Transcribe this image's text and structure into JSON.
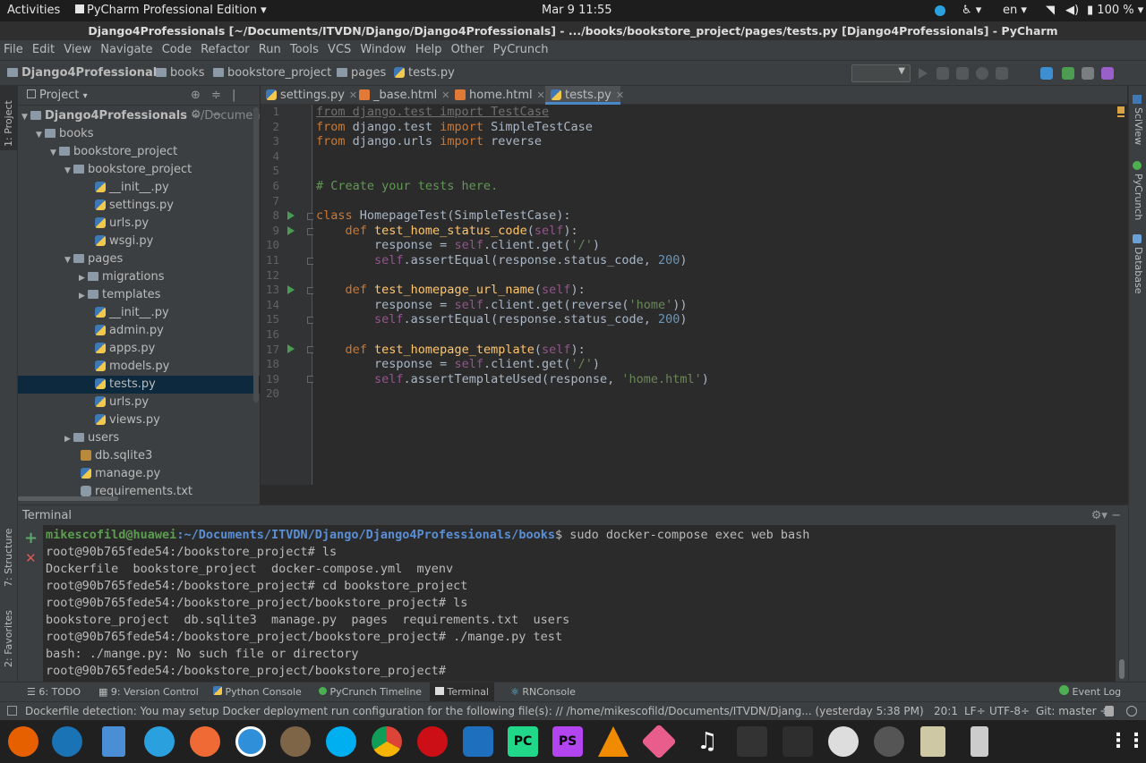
{
  "topbar": {
    "activities": "Activities",
    "app_menu": "PyCharm Professional Edition",
    "datetime": "Mar 9  11:55",
    "lang": "en",
    "battery": "100 %"
  },
  "window": {
    "title": "Django4Professionals [~/Documents/ITVDN/Django/Django4Professionals] - .../books/bookstore_project/pages/tests.py [Django4Professionals] - PyCharm"
  },
  "menu": [
    "File",
    "Edit",
    "View",
    "Navigate",
    "Code",
    "Refactor",
    "Run",
    "Tools",
    "VCS",
    "Window",
    "Help",
    "Other",
    "PyCrunch"
  ],
  "breadcrumbs": [
    "Django4Professionals",
    "books",
    "bookstore_project",
    "pages",
    "tests.py"
  ],
  "project": {
    "header": "Project",
    "tree": [
      {
        "label": "Django4Professionals",
        "extra": "~/Documents/IT"
      },
      {
        "label": "books"
      },
      {
        "label": "bookstore_project"
      },
      {
        "label": "bookstore_project"
      },
      {
        "label": "__init__.py"
      },
      {
        "label": "settings.py"
      },
      {
        "label": "urls.py"
      },
      {
        "label": "wsgi.py"
      },
      {
        "label": "pages"
      },
      {
        "label": "migrations"
      },
      {
        "label": "templates"
      },
      {
        "label": "__init__.py"
      },
      {
        "label": "admin.py"
      },
      {
        "label": "apps.py"
      },
      {
        "label": "models.py"
      },
      {
        "label": "tests.py"
      },
      {
        "label": "urls.py"
      },
      {
        "label": "views.py"
      },
      {
        "label": "users"
      },
      {
        "label": "db.sqlite3"
      },
      {
        "label": "manage.py"
      },
      {
        "label": "requirements.txt"
      }
    ]
  },
  "tabs": [
    "settings.py",
    "_base.html",
    "home.html",
    "tests.py"
  ],
  "editor": {
    "line_numbers": [
      "1",
      "2",
      "3",
      "4",
      "5",
      "6",
      "7",
      "8",
      "9",
      "10",
      "11",
      "12",
      "13",
      "14",
      "15",
      "16",
      "17",
      "18",
      "19",
      "20"
    ],
    "lines": {
      "l1": "from django.test import TestCase",
      "l2a": "from",
      "l2b": " django.test ",
      "l2c": "import",
      "l2d": " SimpleTestCase",
      "l3a": "from",
      "l3b": " django.urls ",
      "l3c": "import",
      "l3d": " reverse",
      "l6": "# Create your tests here.",
      "l8a": "class",
      "l8b": " HomepageTest",
      "l8c": "(SimpleTestCase):",
      "l9a": "    def",
      "l9b": " test_home_status_code",
      "l9c": "(",
      "l9d": "self",
      "l9e": "):",
      "l10a": "        response = ",
      "l10b": "self",
      "l10c": ".client.get(",
      "l10d": "'/'",
      "l10e": ")",
      "l11a": "        ",
      "l11b": "self",
      "l11c": ".assertEqual(response.status_code, ",
      "l11d": "200",
      "l11e": ")",
      "l13a": "    def",
      "l13b": " test_homepage_url_name",
      "l13c": "(",
      "l13d": "self",
      "l13e": "):",
      "l14a": "        response = ",
      "l14b": "self",
      "l14c": ".client.get(reverse(",
      "l14d": "'home'",
      "l14e": "))",
      "l15a": "        ",
      "l15b": "self",
      "l15c": ".assertEqual(response.status_code, ",
      "l15d": "200",
      "l15e": ")",
      "l17a": "    def",
      "l17b": " test_homepage_template",
      "l17c": "(",
      "l17d": "self",
      "l17e": "):",
      "l18a": "        response = ",
      "l18b": "self",
      "l18c": ".client.get(",
      "l18d": "'/'",
      "l18e": ")",
      "l19a": "        ",
      "l19b": "self",
      "l19c": ".assertTemplateUsed(response, ",
      "l19d": "'home.html'",
      "l19e": ")"
    }
  },
  "right_tools": [
    "SciView",
    "PyCrunch",
    "Database"
  ],
  "left_tools": [
    "1: Project",
    "7: Structure",
    "2: Favorites"
  ],
  "terminal": {
    "title": "Terminal",
    "user": "mikescofild@huawei",
    "path": ":~/Documents/ITVDN/Django/Django4Professionals/books",
    "cmd": "$ sudo docker-compose exec web bash",
    "lines": [
      "root@90b765fede54:/bookstore_project# ls",
      "Dockerfile  bookstore_project  docker-compose.yml  myenv",
      "root@90b765fede54:/bookstore_project# cd bookstore_project",
      "root@90b765fede54:/bookstore_project/bookstore_project# ls",
      "bookstore_project  db.sqlite3  manage.py  pages  requirements.txt  users",
      "root@90b765fede54:/bookstore_project/bookstore_project# ./mange.py test",
      "bash: ./mange.py: No such file or directory",
      "root@90b765fede54:/bookstore_project/bookstore_project#"
    ]
  },
  "toolwindows": [
    "6: TODO",
    "9: Version Control",
    "Python Console",
    "PyCrunch Timeline",
    "Terminal",
    "RNConsole",
    "Event Log"
  ],
  "status": {
    "message": "Dockerfile detection: You may setup Docker deployment run configuration for the following file(s): // /home/mikescofild/Documents/ITVDN/Djang... (yesterday 5:38 PM)",
    "position": "20:1",
    "line_sep": "LF÷",
    "encoding": "UTF-8÷",
    "git": "Git: master ÷"
  },
  "dock": {
    "pycharm": "PC",
    "phpstorm": "PS"
  }
}
